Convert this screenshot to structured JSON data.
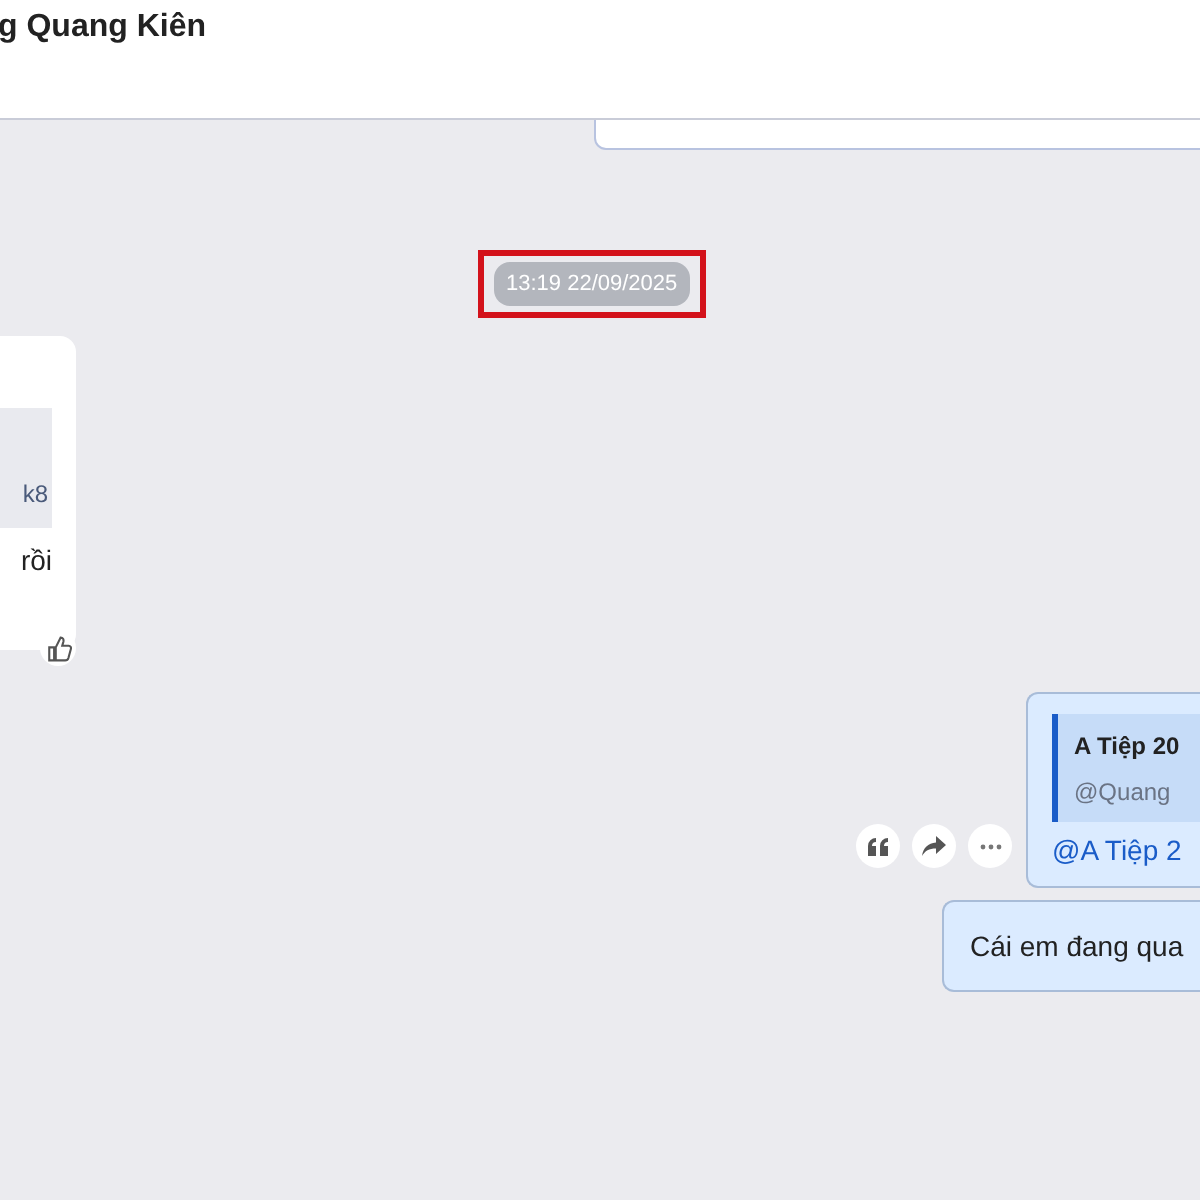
{
  "header": {
    "title": "g Quang Kiên"
  },
  "timestamp": {
    "text": "13:19 22/09/2025",
    "highlighted": true
  },
  "messages": [
    {
      "kind": "incoming",
      "quote": {
        "text": "k8"
      },
      "text": "rồi"
    },
    {
      "kind": "outgoing",
      "quote": {
        "author": "A Tiệp 20",
        "text": "@Quang"
      },
      "text": "@A Tiệp 2",
      "actions": true
    },
    {
      "kind": "outgoing",
      "text": "Cái em đang qua",
      "actions": false
    }
  ]
}
